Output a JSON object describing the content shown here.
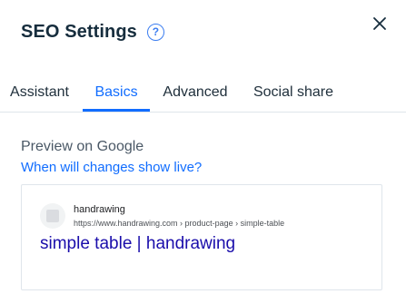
{
  "header": {
    "title": "SEO Settings",
    "help_glyph": "?"
  },
  "tabs": [
    {
      "label": "Assistant",
      "active": false
    },
    {
      "label": "Basics",
      "active": true
    },
    {
      "label": "Advanced",
      "active": false
    },
    {
      "label": "Social share",
      "active": false
    }
  ],
  "preview": {
    "label": "Preview on Google",
    "link": "When will changes show live?",
    "card": {
      "site_name": "handrawing",
      "url": "https://www.handrawing.com › product-page › simple-table",
      "title": "simple table | handrawing"
    }
  },
  "colors": {
    "accent": "#116dff",
    "result_title": "#1a0dab",
    "text": "#20303c"
  },
  "icons": {
    "help": "question-circle-icon",
    "close": "close-icon",
    "favicon": "globe-placeholder-icon"
  }
}
